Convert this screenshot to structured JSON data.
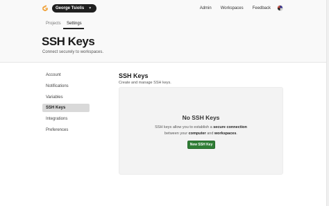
{
  "header": {
    "user_name": "George Tsiolis",
    "nav": [
      "Admin",
      "Workspaces",
      "Feedback"
    ]
  },
  "tabs": [
    "Projects",
    "Settings"
  ],
  "active_tab": "Settings",
  "page": {
    "title": "SSH Keys",
    "subtitle": "Connect securely to workspaces."
  },
  "sidebar": {
    "items": [
      "Account",
      "Notifications",
      "Variables",
      "SSH Keys",
      "Integrations",
      "Preferences"
    ],
    "active": "SSH Keys"
  },
  "main": {
    "title": "SSH Keys",
    "subtitle": "Create and manage SSH keys.",
    "empty_title": "No SSH Keys",
    "desc_line1_a": "SSH keys allow you to establish a ",
    "desc_line1_b": "secure connection",
    "desc_line2_a": "between your ",
    "desc_line2_b": "computer",
    "desc_line2_c": " and ",
    "desc_line2_d": "workspaces",
    "desc_line2_e": ".",
    "button_label": "New SSH Key"
  },
  "colors": {
    "accent_button": "#2f7d35",
    "logo": "#f0a23a"
  }
}
